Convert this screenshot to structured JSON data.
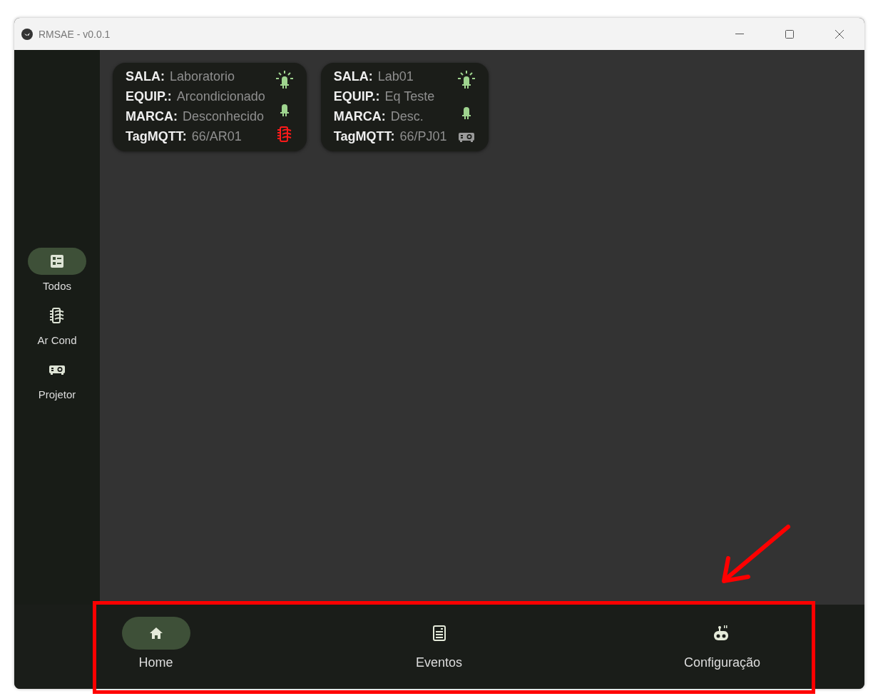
{
  "window": {
    "title": "RMSAE - v0.0.1"
  },
  "sidebar": {
    "items": [
      {
        "kind": "all",
        "label": "Todos",
        "selected": true
      },
      {
        "kind": "ac",
        "label": "Ar Cond",
        "selected": false
      },
      {
        "kind": "projector",
        "label": "Projetor",
        "selected": false
      }
    ]
  },
  "cards": [
    {
      "fields": [
        {
          "label": "SALA:",
          "value": "Laboratorio"
        },
        {
          "label": "EQUIP.:",
          "value": "Arcondicionado"
        },
        {
          "label": "MARCA:",
          "value": "Desconhecido"
        },
        {
          "label": "TagMQTT:",
          "value": "66/AR01"
        }
      ],
      "light_on": true,
      "kind": "ac",
      "alarm": true
    },
    {
      "fields": [
        {
          "label": "SALA:",
          "value": "Lab01"
        },
        {
          "label": "EQUIP.:",
          "value": "Eq Teste"
        },
        {
          "label": "MARCA:",
          "value": "Desc."
        },
        {
          "label": "TagMQTT:",
          "value": "66/PJ01"
        }
      ],
      "light_on": true,
      "kind": "projector",
      "alarm": false
    }
  ],
  "bottom_nav": {
    "items": [
      {
        "kind": "home",
        "label": "Home",
        "selected": true
      },
      {
        "kind": "events",
        "label": "Eventos",
        "selected": false
      },
      {
        "kind": "settings",
        "label": "Configuração",
        "selected": false
      }
    ]
  }
}
